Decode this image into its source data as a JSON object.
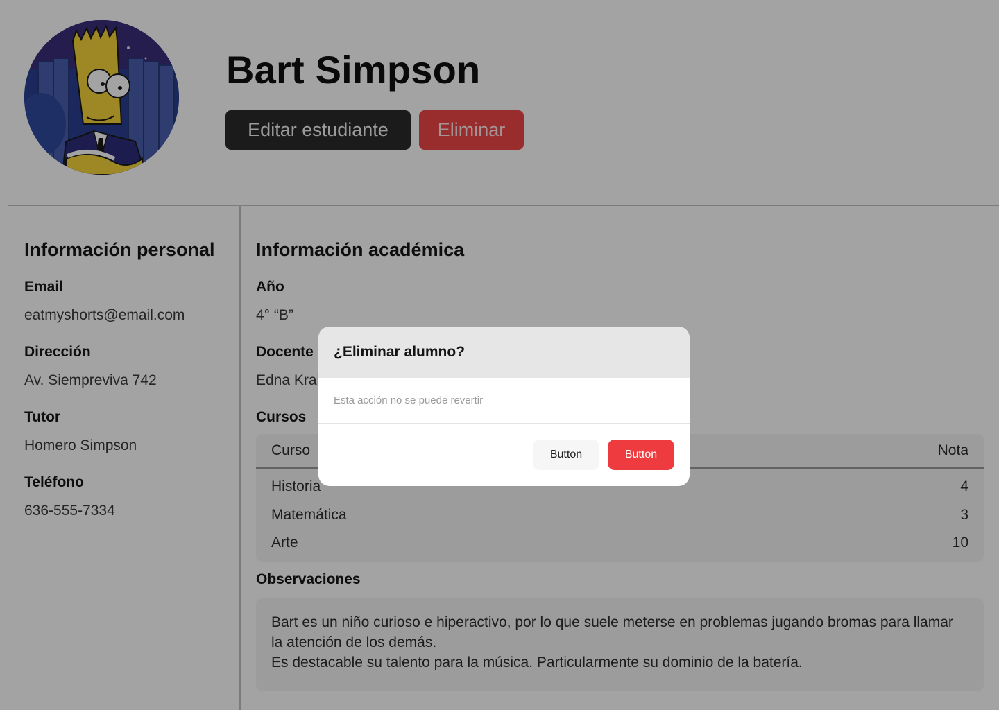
{
  "student": {
    "name": "Bart Simpson",
    "edit_label": "Editar estudiante",
    "delete_label": "Eliminar"
  },
  "personal": {
    "title": "Información personal",
    "fields": [
      {
        "label": "Email",
        "value": "eatmyshorts@email.com"
      },
      {
        "label": "Dirección",
        "value": "Av. Siempreviva 742"
      },
      {
        "label": "Tutor",
        "value": "Homero Simpson"
      },
      {
        "label": "Teléfono",
        "value": "636-555-7334"
      }
    ]
  },
  "academic": {
    "title": "Información académica",
    "year_label": "Año",
    "year_value": "4° “B”",
    "teacher_label": "Docente",
    "teacher_value": "Edna Krabappel",
    "courses_label": "Cursos",
    "courses": {
      "headers": [
        "Curso",
        "Nota"
      ],
      "rows": [
        {
          "course": "Historia",
          "grade": "4"
        },
        {
          "course": "Matemática",
          "grade": "3"
        },
        {
          "course": "Arte",
          "grade": "10"
        }
      ]
    },
    "observations_label": "Observaciones",
    "observations": [
      "Bart es un niño curioso e hiperactivo, por lo que suele meterse en problemas jugando bromas para llamar la atención de los demás.",
      "Es destacable su talento para la música. Particularmente su dominio de la batería."
    ]
  },
  "modal": {
    "title": "¿Eliminar alumno?",
    "message": "Esta acción no se puede revertir",
    "secondary_label": "Button",
    "primary_label": "Button"
  },
  "colors": {
    "overlay": "rgba(0,0,0,0.36)",
    "danger": "#ee3b3f",
    "dark_button": "#2b2b2b"
  },
  "icons": {
    "avatar": "student-avatar-image"
  }
}
